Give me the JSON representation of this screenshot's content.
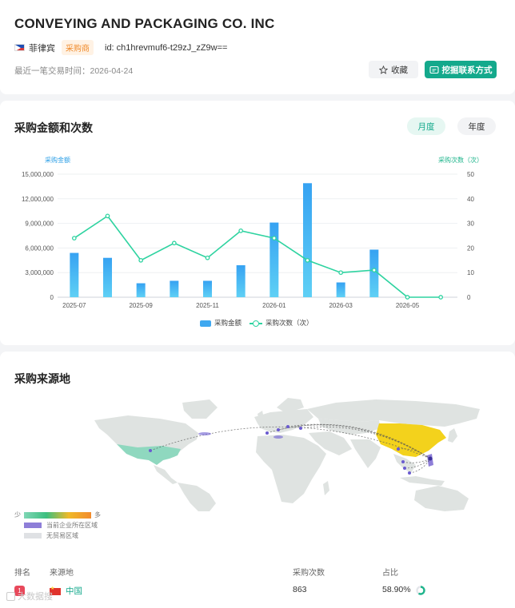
{
  "header": {
    "company_name": "CONVEYING AND PACKAGING CO. INC",
    "country": "菲律宾",
    "role_badge": "采购商",
    "id_text": "id: ch1hrevmuf6-t29zJ_zZ9w==",
    "last_trade": "最近一笔交易时间：2026-04-24",
    "favorite_label": "收藏",
    "contact_label": "挖掘联系方式",
    "badge_color": "#f08a2a",
    "accent_color": "#14a98c"
  },
  "purchase_chart": {
    "title": "采购金额和次数",
    "tab_month": "月度",
    "tab_year": "年度",
    "left_axis_label": "采购金额",
    "right_axis_label": "采购次数（次）",
    "legend_amount": "采购金额",
    "legend_count": "采购次数（次）"
  },
  "chart_data": {
    "type": "bar",
    "categories": [
      "2025-07",
      "2025-08",
      "2025-09",
      "2025-10",
      "2025-11",
      "2025-12",
      "2026-01",
      "2026-02",
      "2026-03",
      "2026-04",
      "2026-05",
      "2026-06"
    ],
    "x_tick_labels": [
      "2025-07",
      "2025-09",
      "2025-11",
      "2026-01",
      "2026-03",
      "2026-05"
    ],
    "series": [
      {
        "name": "采购金额",
        "type": "bar",
        "axis": "left",
        "color": "#3fa8f0",
        "values": [
          5400000,
          4800000,
          1700000,
          2000000,
          2000000,
          3900000,
          9100000,
          13900000,
          1800000,
          5800000,
          0,
          0
        ]
      },
      {
        "name": "采购次数（次）",
        "type": "line",
        "axis": "right",
        "color": "#2ed3a0",
        "values": [
          24,
          33,
          15,
          22,
          16,
          27,
          24,
          15,
          10,
          11,
          0,
          0
        ]
      }
    ],
    "left_ticks": [
      "0",
      "3,000,000",
      "6,000,000",
      "9,000,000",
      "12,000,000",
      "15,000,000"
    ],
    "right_ticks": [
      "0",
      "10",
      "20",
      "30",
      "40",
      "50"
    ],
    "ylim_left": [
      0,
      15000000
    ],
    "ylim_right": [
      0,
      50
    ]
  },
  "source_map": {
    "title": "采购来源地",
    "legend_min": "少",
    "legend_max": "多",
    "legend_current_region": "当前企业所在区域",
    "legend_no_trade": "无贸易区域"
  },
  "source_table": {
    "col_rank": "排名",
    "col_source": "来源地",
    "col_count": "采购次数",
    "col_ratio": "占比",
    "rows": [
      {
        "rank": "1",
        "country": "中国",
        "count": "863",
        "ratio": "58.90%",
        "ratio_value": 0.589
      }
    ]
  },
  "watermark": "大数据搜"
}
